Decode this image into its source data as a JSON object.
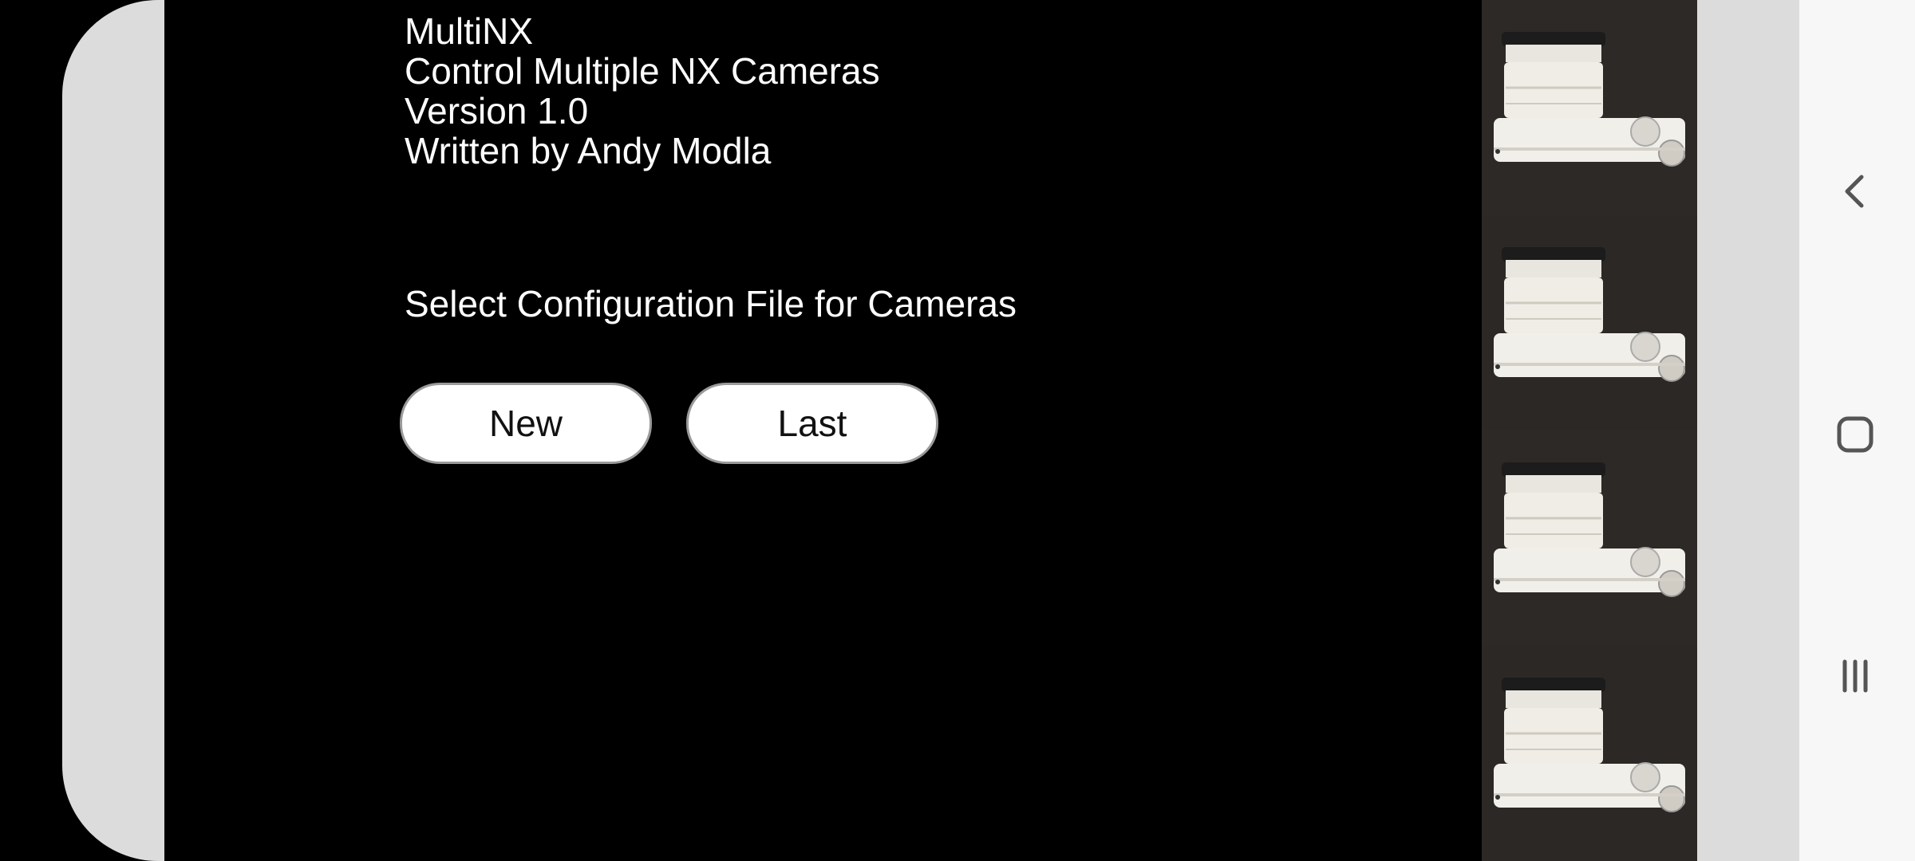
{
  "app": {
    "info_lines": [
      "MultiNX",
      "Control Multiple NX Cameras",
      "Version 1.0",
      "Written by Andy Modla"
    ],
    "prompt": "Select Configuration File for Cameras",
    "buttons": {
      "new_label": "New",
      "last_label": "Last"
    }
  },
  "camera_previews": [
    {
      "icon": "camera-preview-icon"
    },
    {
      "icon": "camera-preview-icon"
    },
    {
      "icon": "camera-preview-icon"
    },
    {
      "icon": "camera-preview-icon"
    }
  ],
  "navbar": {
    "back_icon": "back-chevron-icon",
    "home_icon": "home-square-icon",
    "recents_icon": "recents-bars-icon"
  },
  "colors": {
    "app_background": "#000000",
    "text": "#ffffff",
    "button_bg": "#ffffff",
    "button_border": "#9a9a9a",
    "navbar_bg": "#f7f7f7"
  }
}
